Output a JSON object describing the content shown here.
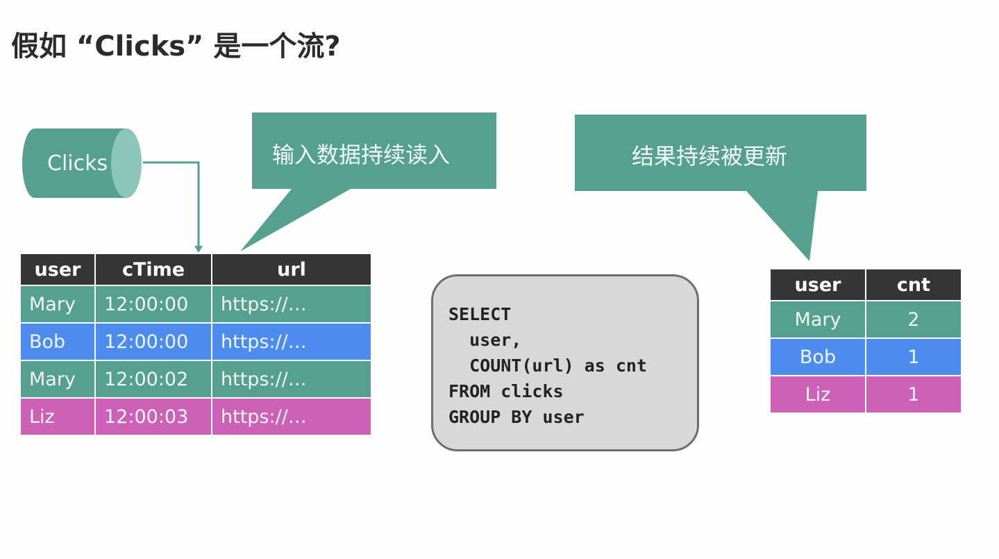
{
  "title": "假如 “Clicks” 是一个流?",
  "source": {
    "label": "Clicks"
  },
  "callouts": {
    "input": "输入数据持续读入",
    "output": "结果持续被更新"
  },
  "colors": {
    "teal": "#55a08f",
    "blue": "#4d8cef",
    "magenta": "#cd61b8",
    "header": "#363535",
    "sql_bg": "#d8d8d8"
  },
  "input_table": {
    "headers": [
      "user",
      "cTime",
      "url"
    ],
    "rows": [
      {
        "cells": [
          "Mary",
          "12:00:00",
          "https://…"
        ],
        "color": "#55a08f"
      },
      {
        "cells": [
          "Bob",
          "12:00:00",
          "https://…"
        ],
        "color": "#4d8cef"
      },
      {
        "cells": [
          "Mary",
          "12:00:02",
          "https://…"
        ],
        "color": "#55a08f"
      },
      {
        "cells": [
          "Liz",
          "12:00:03",
          "https://…"
        ],
        "color": "#cd61b8"
      }
    ]
  },
  "query": {
    "lines": [
      "SELECT",
      "  user,",
      "  COUNT(url) as cnt",
      "FROM clicks",
      "GROUP BY user"
    ]
  },
  "result_table": {
    "headers": [
      "user",
      "cnt"
    ],
    "rows": [
      {
        "cells": [
          "Mary",
          "2"
        ],
        "color": "#55a08f"
      },
      {
        "cells": [
          "Bob",
          "1"
        ],
        "color": "#4d8cef"
      },
      {
        "cells": [
          "Liz",
          "1"
        ],
        "color": "#cd61b8"
      }
    ]
  }
}
